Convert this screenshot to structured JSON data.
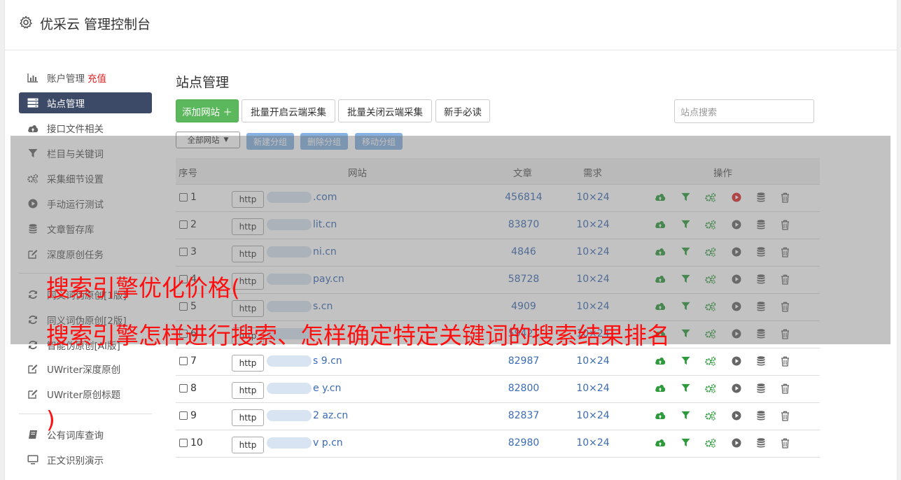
{
  "header": {
    "title": "优采云 管理控制台"
  },
  "sidebar": {
    "items": [
      {
        "label": "账户管理",
        "badge": "充值",
        "icon": "bar-chart-icon"
      },
      {
        "label": "站点管理",
        "icon": "server-icon",
        "active": true
      },
      {
        "label": "接口文件相关",
        "icon": "cloud-upload-icon"
      },
      {
        "label": "栏目与关键词",
        "icon": "filter-icon"
      },
      {
        "label": "采集细节设置",
        "icon": "gears-icon"
      },
      {
        "label": "手动运行测试",
        "icon": "play-circle-icon"
      },
      {
        "label": "文章暂存库",
        "icon": "database-icon"
      },
      {
        "label": "深度原创任务",
        "icon": "edit-icon"
      },
      {
        "label": "同义词伪原创[1版]",
        "icon": "refresh-icon"
      },
      {
        "label": "同义词伪原创[2版]",
        "icon": "refresh-icon"
      },
      {
        "label": "智能伪原创[AI版]",
        "icon": "refresh-icon"
      },
      {
        "label": "UWriter深度原创",
        "icon": "edit-icon"
      },
      {
        "label": "UWriter原创标题",
        "icon": "edit-icon"
      },
      {
        "label": "公有词库查询",
        "icon": "book-icon"
      },
      {
        "label": "正文识别演示",
        "icon": "monitor-icon"
      }
    ]
  },
  "main": {
    "title": "站点管理",
    "buttons": {
      "add": "添加网站 ＋",
      "batch_open": "批量开启云端采集",
      "batch_close": "批量关闭云端采集",
      "guide": "新手必读"
    },
    "search_placeholder": "站点搜索",
    "group_select": "全部网站",
    "group_buttons": {
      "new": "新建分组",
      "delete": "删除分组",
      "move": "移动分组"
    },
    "table": {
      "headers": {
        "index": "序号",
        "site": "网站",
        "articles": "文章",
        "demand": "需求",
        "actions": "操作"
      },
      "rows": [
        {
          "index": "1",
          "protocol": "http",
          "site": ".com",
          "articles": "456814",
          "demand": "10×24",
          "run_active": true
        },
        {
          "index": "2",
          "protocol": "http",
          "site": "lit.cn",
          "articles": "83870",
          "demand": "10×24",
          "run_active": false
        },
        {
          "index": "3",
          "protocol": "http",
          "site": "ni.cn",
          "articles": "4846",
          "demand": "10×24",
          "run_active": false
        },
        {
          "index": "4",
          "protocol": "http",
          "site": "pay.cn",
          "articles": "58728",
          "demand": "10×24",
          "run_active": false
        },
        {
          "index": "5",
          "protocol": "http",
          "site": "s.cn",
          "articles": "4909",
          "demand": "10×24",
          "run_active": false
        },
        {
          "index": "6",
          "protocol": "http",
          "site": "",
          "articles": "59421",
          "demand": "10×24",
          "run_active": false
        },
        {
          "index": "7",
          "protocol": "http",
          "site": "s 9.cn",
          "articles": "82987",
          "demand": "10×24",
          "run_active": false
        },
        {
          "index": "8",
          "protocol": "http",
          "site": "e y.cn",
          "articles": "82800",
          "demand": "10×24",
          "run_active": false
        },
        {
          "index": "9",
          "protocol": "http",
          "site": "2 az.cn",
          "articles": "82837",
          "demand": "10×24",
          "run_active": false
        },
        {
          "index": "10",
          "protocol": "http",
          "site": "v p.cn",
          "articles": "82980",
          "demand": "10×24",
          "run_active": false
        }
      ]
    }
  },
  "overlay_text": {
    "line1": "搜索引擎优化价格(",
    "line2": "搜索引擎怎样进行搜索、怎样确定特定关键词的搜索结果排名",
    "line3": ")"
  },
  "colors": {
    "accent_green": "#5cb85c",
    "sidebar_active": "#3c4a67",
    "link_blue": "#3a6bb4",
    "overlay_red": "#ff1010"
  }
}
